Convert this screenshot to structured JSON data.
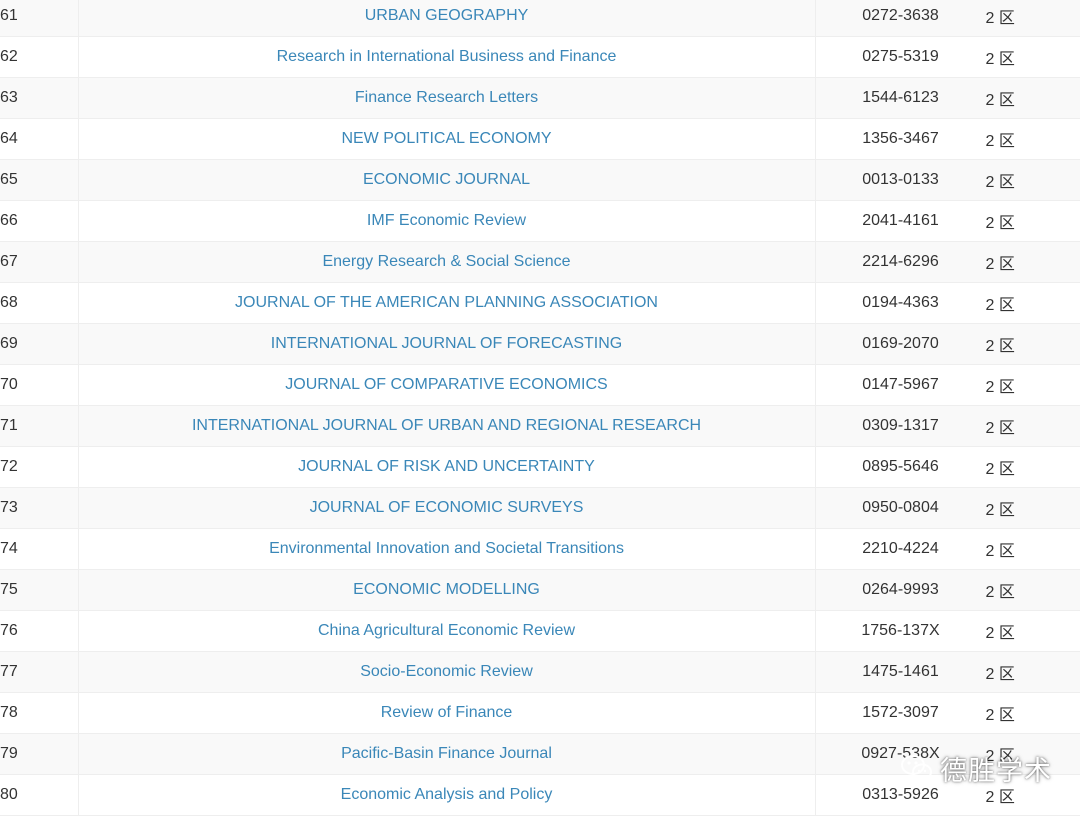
{
  "rows": [
    {
      "no": "61",
      "title": "URBAN GEOGRAPHY",
      "issn": "0272-3638",
      "zone": "2 区"
    },
    {
      "no": "62",
      "title": "Research in International Business and Finance",
      "issn": "0275-5319",
      "zone": "2 区"
    },
    {
      "no": "63",
      "title": "Finance Research Letters",
      "issn": "1544-6123",
      "zone": "2 区"
    },
    {
      "no": "64",
      "title": "NEW POLITICAL ECONOMY",
      "issn": "1356-3467",
      "zone": "2 区"
    },
    {
      "no": "65",
      "title": "ECONOMIC JOURNAL",
      "issn": "0013-0133",
      "zone": "2 区"
    },
    {
      "no": "66",
      "title": "IMF Economic Review",
      "issn": "2041-4161",
      "zone": "2 区"
    },
    {
      "no": "67",
      "title": "Energy Research & Social Science",
      "issn": "2214-6296",
      "zone": "2 区"
    },
    {
      "no": "68",
      "title": "JOURNAL OF THE AMERICAN PLANNING ASSOCIATION",
      "issn": "0194-4363",
      "zone": "2 区"
    },
    {
      "no": "69",
      "title": "INTERNATIONAL JOURNAL OF FORECASTING",
      "issn": "0169-2070",
      "zone": "2 区"
    },
    {
      "no": "70",
      "title": "JOURNAL OF COMPARATIVE ECONOMICS",
      "issn": "0147-5967",
      "zone": "2 区"
    },
    {
      "no": "71",
      "title": "INTERNATIONAL JOURNAL OF URBAN AND REGIONAL RESEARCH",
      "issn": "0309-1317",
      "zone": "2 区"
    },
    {
      "no": "72",
      "title": "JOURNAL OF RISK AND UNCERTAINTY",
      "issn": "0895-5646",
      "zone": "2 区"
    },
    {
      "no": "73",
      "title": "JOURNAL OF ECONOMIC SURVEYS",
      "issn": "0950-0804",
      "zone": "2 区"
    },
    {
      "no": "74",
      "title": "Environmental Innovation and Societal Transitions",
      "issn": "2210-4224",
      "zone": "2 区"
    },
    {
      "no": "75",
      "title": "ECONOMIC MODELLING",
      "issn": "0264-9993",
      "zone": "2 区"
    },
    {
      "no": "76",
      "title": "China Agricultural Economic Review",
      "issn": "1756-137X",
      "zone": "2 区"
    },
    {
      "no": "77",
      "title": "Socio-Economic Review",
      "issn": "1475-1461",
      "zone": "2 区"
    },
    {
      "no": "78",
      "title": "Review of Finance",
      "issn": "1572-3097",
      "zone": "2 区"
    },
    {
      "no": "79",
      "title": "Pacific-Basin Finance Journal",
      "issn": "0927-538X",
      "zone": "2 区"
    },
    {
      "no": "80",
      "title": "Economic Analysis and Policy",
      "issn": "0313-5926",
      "zone": "2 区"
    }
  ],
  "watermark": {
    "text": "德胜学术",
    "icon": "wechat-icon"
  },
  "colors": {
    "link": "#3a87b8",
    "text": "#333333",
    "stripe": "#f9f9f9",
    "border": "#eeeeee"
  }
}
